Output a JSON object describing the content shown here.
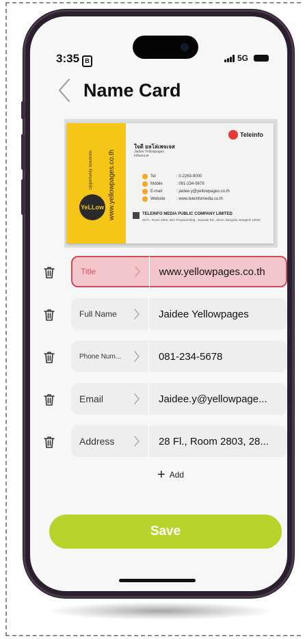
{
  "status_bar": {
    "time": "3:35",
    "sim_badge": "B",
    "network": "5G"
  },
  "header": {
    "title": "Name Card"
  },
  "card": {
    "brand": "Teleinfo",
    "person_name": "ใจดี ยลโล่เพจเจส",
    "person_name_en": "Jaidee Yellowpages",
    "person_role": "Influencer",
    "vertical_url": "www.yellowpages.co.th",
    "vertical_tag": "Opportunity Solutions",
    "logo_text": "YeLLow Pages",
    "rows": [
      {
        "label": "Tel",
        "value": ": 0-2263-8000"
      },
      {
        "label": "Mobile",
        "value": ": 081-234-5678"
      },
      {
        "label": "E-mail",
        "value": ": jaidee.y@yellowpages.co.th"
      },
      {
        "label": "Website",
        "value": ": www.teleinfomedia.co.th"
      }
    ],
    "company": "TELEINFO MEDIA PUBLIC COMPANY LIMITED",
    "company_address": "28 Fl., Room 2803, 28/1 Prapawit Bldg., Surasak Rd., Silom, Bangrak, Bangkok 10500"
  },
  "fields": [
    {
      "label": "Title",
      "value": "www.yellowpages.co.th",
      "highlighted": true
    },
    {
      "label": "Full Name",
      "value": "Jaidee Yellowpages",
      "highlighted": false
    },
    {
      "label": "Phone Num...",
      "value": "081-234-5678",
      "highlighted": false
    },
    {
      "label": "Email",
      "value": "Jaidee.y@yellowpage...",
      "highlighted": false
    },
    {
      "label": "Address",
      "value": "28 Fl., Room 2803, 28...",
      "highlighted": false
    }
  ],
  "actions": {
    "add_label": "Add",
    "save_label": "Save"
  },
  "colors": {
    "accent": "#b7d32c",
    "highlight_border": "#c94a5a",
    "highlight_fill": "#f2c6cb",
    "card_yellow": "#f5c518"
  }
}
